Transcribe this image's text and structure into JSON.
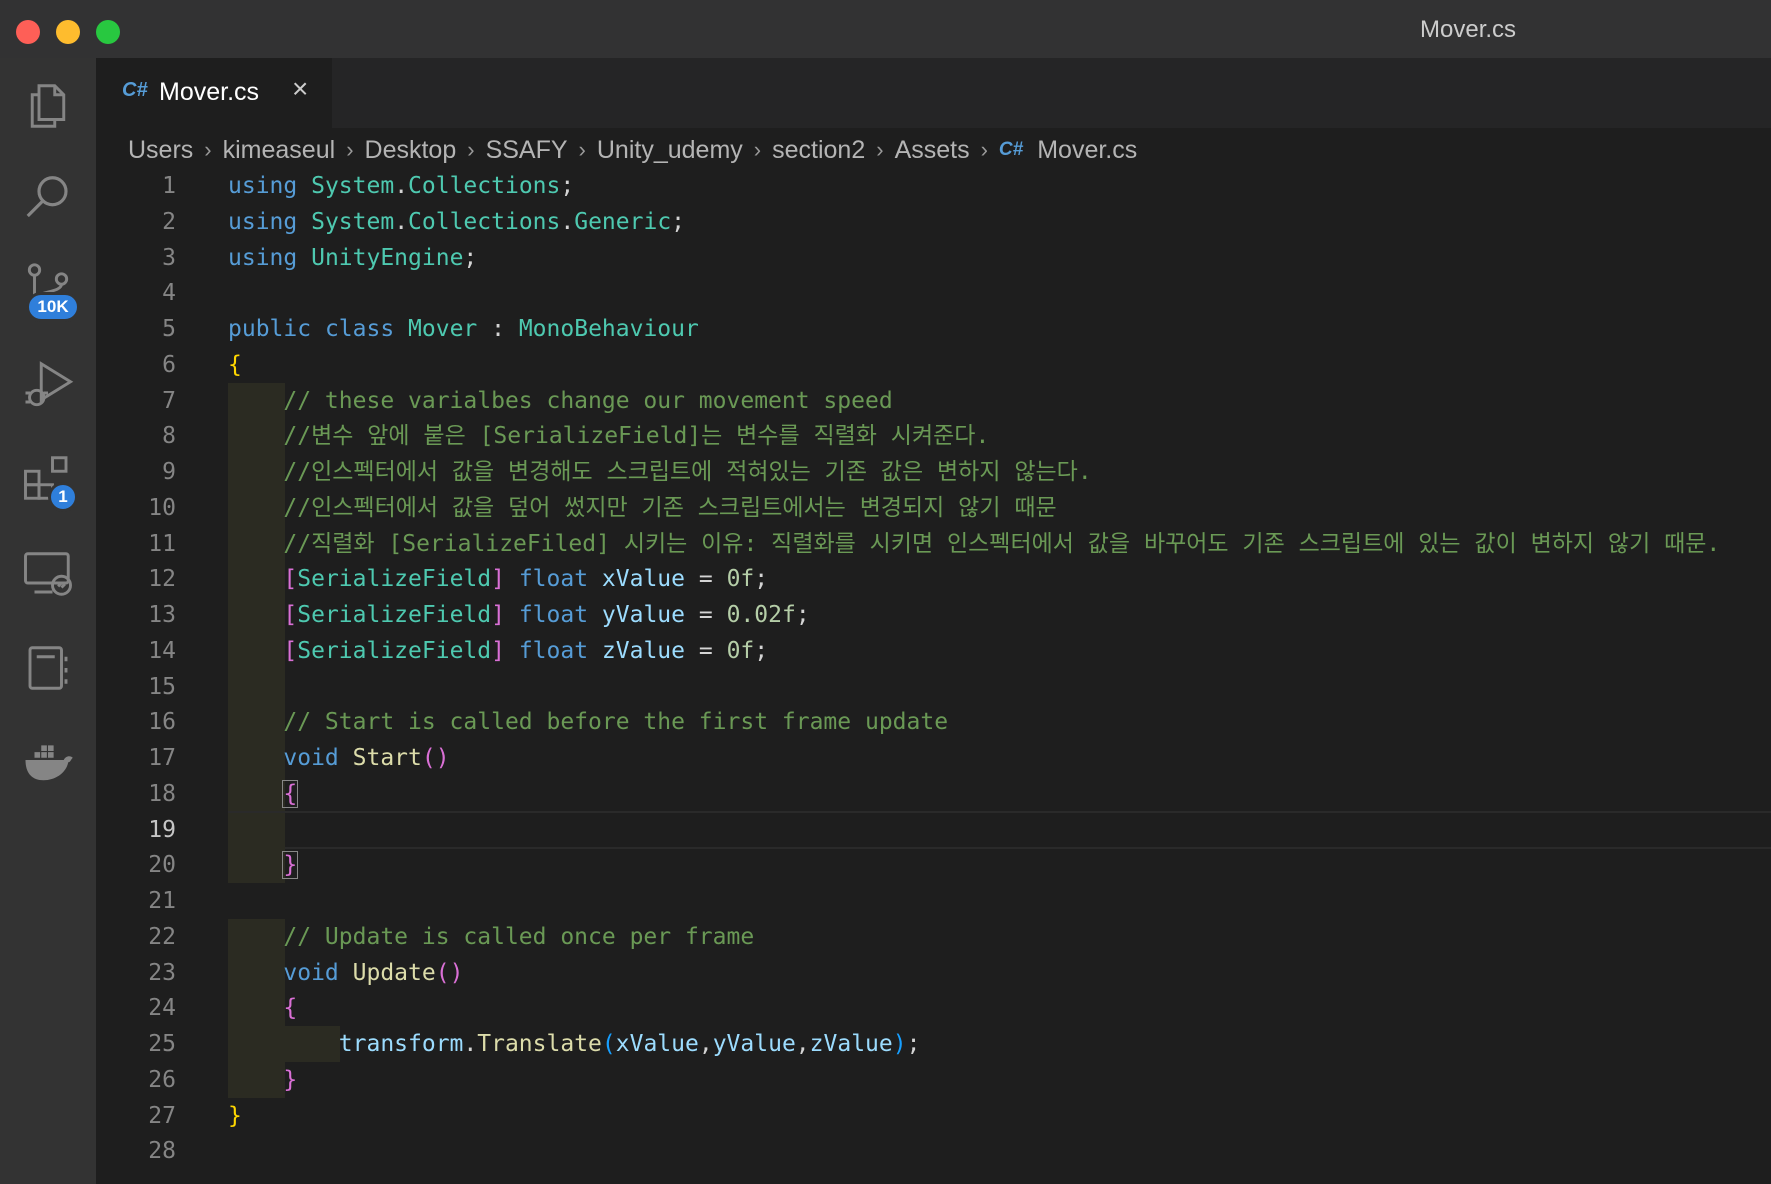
{
  "window": {
    "title": "Mover.cs"
  },
  "activity_bar": {
    "items": [
      {
        "name": "explorer-icon"
      },
      {
        "name": "search-icon"
      },
      {
        "name": "source-control-icon",
        "badge": "10K"
      },
      {
        "name": "run-debug-icon"
      },
      {
        "name": "extensions-icon",
        "badge": "1"
      },
      {
        "name": "remote-explorer-icon"
      },
      {
        "name": "notebook-icon"
      },
      {
        "name": "docker-icon"
      }
    ]
  },
  "tab": {
    "icon": "C#",
    "label": "Mover.cs",
    "close": "×"
  },
  "breadcrumb": {
    "parts": [
      "Users",
      "kimeaseul",
      "Desktop",
      "SSAFY",
      "Unity_udemy",
      "section2",
      "Assets"
    ],
    "file_icon": "C#",
    "file": "Mover.cs",
    "separator": "›"
  },
  "editor": {
    "current_line": 19,
    "lines": [
      [
        {
          "t": "using ",
          "c": "kw"
        },
        {
          "t": "System",
          "c": "ty"
        },
        {
          "t": ".",
          "c": "pu"
        },
        {
          "t": "Collections",
          "c": "ty"
        },
        {
          "t": ";",
          "c": "pu"
        }
      ],
      [
        {
          "t": "using ",
          "c": "kw"
        },
        {
          "t": "System",
          "c": "ty"
        },
        {
          "t": ".",
          "c": "pu"
        },
        {
          "t": "Collections",
          "c": "ty"
        },
        {
          "t": ".",
          "c": "pu"
        },
        {
          "t": "Generic",
          "c": "ty"
        },
        {
          "t": ";",
          "c": "pu"
        }
      ],
      [
        {
          "t": "using ",
          "c": "kw"
        },
        {
          "t": "UnityEngine",
          "c": "ty"
        },
        {
          "t": ";",
          "c": "pu"
        }
      ],
      [],
      [
        {
          "t": "public ",
          "c": "kw"
        },
        {
          "t": "class ",
          "c": "kw"
        },
        {
          "t": "Mover",
          "c": "ty"
        },
        {
          "t": " : ",
          "c": "pu"
        },
        {
          "t": "MonoBehaviour",
          "c": "ty"
        }
      ],
      [
        {
          "t": "{",
          "c": "br1"
        }
      ],
      [
        {
          "t": "    ",
          "c": "pu"
        },
        {
          "t": "// these varialbes change our movement speed",
          "c": "cm"
        }
      ],
      [
        {
          "t": "    ",
          "c": "pu"
        },
        {
          "t": "//변수 앞에 붙은 [SerializeField]는 변수를 직렬화 시켜준다.",
          "c": "cm"
        }
      ],
      [
        {
          "t": "    ",
          "c": "pu"
        },
        {
          "t": "//인스펙터에서 값을 변경해도 스크립트에 적혀있는 기존 값은 변하지 않는다.",
          "c": "cm"
        }
      ],
      [
        {
          "t": "    ",
          "c": "pu"
        },
        {
          "t": "//인스펙터에서 값을 덮어 썼지만 기존 스크립트에서는 변경되지 않기 때문",
          "c": "cm"
        }
      ],
      [
        {
          "t": "    ",
          "c": "pu"
        },
        {
          "t": "//직렬화 [SerializeFiled] 시키는 이유: 직렬화를 시키면 인스펙터에서 값을 바꾸어도 기존 스크립트에 있는 값이 변하지 않기 때문.",
          "c": "cm"
        }
      ],
      [
        {
          "t": "    ",
          "c": "pu"
        },
        {
          "t": "[",
          "c": "br2"
        },
        {
          "t": "SerializeField",
          "c": "ty"
        },
        {
          "t": "]",
          "c": "br2"
        },
        {
          "t": " float ",
          "c": "kw"
        },
        {
          "t": "xValue",
          "c": "vr"
        },
        {
          "t": " = ",
          "c": "pu"
        },
        {
          "t": "0f",
          "c": "nm"
        },
        {
          "t": ";",
          "c": "pu"
        }
      ],
      [
        {
          "t": "    ",
          "c": "pu"
        },
        {
          "t": "[",
          "c": "br2"
        },
        {
          "t": "SerializeField",
          "c": "ty"
        },
        {
          "t": "]",
          "c": "br2"
        },
        {
          "t": " float ",
          "c": "kw"
        },
        {
          "t": "yValue",
          "c": "vr"
        },
        {
          "t": " = ",
          "c": "pu"
        },
        {
          "t": "0.02f",
          "c": "nm"
        },
        {
          "t": ";",
          "c": "pu"
        }
      ],
      [
        {
          "t": "    ",
          "c": "pu"
        },
        {
          "t": "[",
          "c": "br2"
        },
        {
          "t": "SerializeField",
          "c": "ty"
        },
        {
          "t": "]",
          "c": "br2"
        },
        {
          "t": " float ",
          "c": "kw"
        },
        {
          "t": "zValue",
          "c": "vr"
        },
        {
          "t": " = ",
          "c": "pu"
        },
        {
          "t": "0f",
          "c": "nm"
        },
        {
          "t": ";",
          "c": "pu"
        }
      ],
      [],
      [
        {
          "t": "    ",
          "c": "pu"
        },
        {
          "t": "// Start is called before the first frame update",
          "c": "cm"
        }
      ],
      [
        {
          "t": "    ",
          "c": "pu"
        },
        {
          "t": "void ",
          "c": "kw"
        },
        {
          "t": "Start",
          "c": "fn"
        },
        {
          "t": "()",
          "c": "br2"
        }
      ],
      [
        {
          "t": "    ",
          "c": "pu"
        },
        {
          "t": "{",
          "c": "br2 bracket-box"
        }
      ],
      [],
      [
        {
          "t": "    ",
          "c": "pu"
        },
        {
          "t": "}",
          "c": "br2 bracket-box"
        }
      ],
      [],
      [
        {
          "t": "    ",
          "c": "pu"
        },
        {
          "t": "// Update is called once per frame",
          "c": "cm"
        }
      ],
      [
        {
          "t": "    ",
          "c": "pu"
        },
        {
          "t": "void ",
          "c": "kw"
        },
        {
          "t": "Update",
          "c": "fn"
        },
        {
          "t": "()",
          "c": "br2"
        }
      ],
      [
        {
          "t": "    ",
          "c": "pu"
        },
        {
          "t": "{",
          "c": "br2"
        }
      ],
      [
        {
          "t": "        ",
          "c": "pu"
        },
        {
          "t": "transform",
          "c": "vr"
        },
        {
          "t": ".",
          "c": "pu"
        },
        {
          "t": "Translate",
          "c": "fn"
        },
        {
          "t": "(",
          "c": "br3"
        },
        {
          "t": "xValue",
          "c": "vr"
        },
        {
          "t": ",",
          "c": "pu"
        },
        {
          "t": "yValue",
          "c": "vr"
        },
        {
          "t": ",",
          "c": "pu"
        },
        {
          "t": "zValue",
          "c": "vr"
        },
        {
          "t": ")",
          "c": "br3"
        },
        {
          "t": ";",
          "c": "pu"
        }
      ],
      [
        {
          "t": "    ",
          "c": "pu"
        },
        {
          "t": "}",
          "c": "br2"
        }
      ],
      [
        {
          "t": "}",
          "c": "br1"
        }
      ],
      []
    ]
  }
}
